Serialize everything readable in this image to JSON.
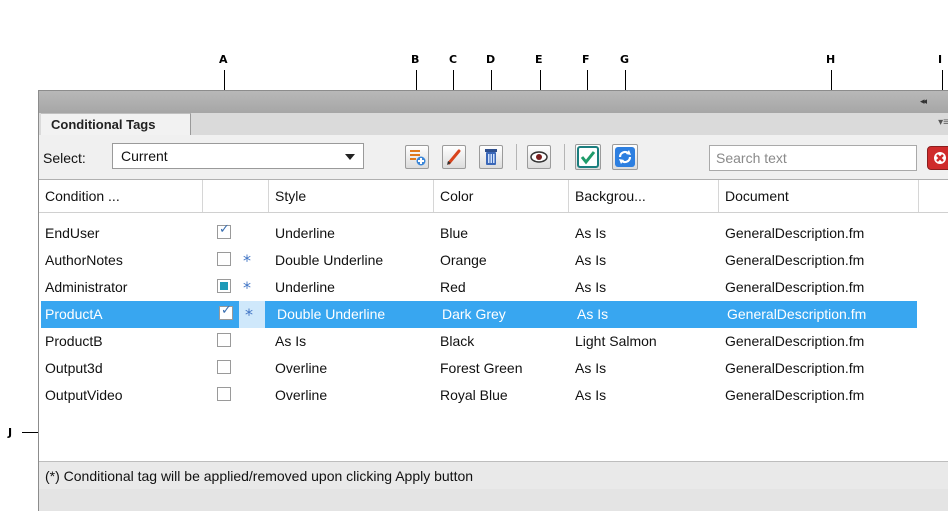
{
  "callouts": {
    "A": "A",
    "B": "B",
    "C": "C",
    "D": "D",
    "E": "E",
    "F": "F",
    "G": "G",
    "H": "H",
    "I": "I",
    "J": "J"
  },
  "panel": {
    "tab_title": "Conditional Tags",
    "collapse_glyph": "◂◂",
    "menu_glyph": "▾≡"
  },
  "toolbar": {
    "select_label": "Select:",
    "select_value": "Current",
    "search_placeholder": "Search text",
    "icons": [
      "new-tag-icon",
      "edit-icon",
      "delete-icon",
      "show-hide-icon",
      "apply-check-icon",
      "refresh-icon",
      "clear-search-icon"
    ]
  },
  "table": {
    "columns": [
      "Condition ...",
      "",
      "Style",
      "Color",
      "Backgrou...",
      "Document"
    ],
    "rows": [
      {
        "name": "EndUser",
        "check": "on",
        "star": "",
        "style": "Underline",
        "color": "Blue",
        "background": "As Is",
        "document": "GeneralDescription.fm"
      },
      {
        "name": "AuthorNotes",
        "check": "off",
        "star": "*",
        "style": "Double Underline",
        "color": "Orange",
        "background": "As Is",
        "document": "GeneralDescription.fm"
      },
      {
        "name": "Administrator",
        "check": "partial",
        "star": "*",
        "style": "Underline",
        "color": "Red",
        "background": "As Is",
        "document": "GeneralDescription.fm"
      },
      {
        "name": "ProductA",
        "check": "on",
        "star": "*",
        "style": "Double Underline",
        "color": "Dark Grey",
        "background": "As Is",
        "document": "GeneralDescription.fm",
        "selected": true
      },
      {
        "name": "ProductB",
        "check": "off",
        "star": "",
        "style": "As Is",
        "color": "Black",
        "background": "Light Salmon",
        "document": "GeneralDescription.fm"
      },
      {
        "name": "Output3d",
        "check": "off",
        "star": "",
        "style": "Overline",
        "color": "Forest Green",
        "background": "As Is",
        "document": "GeneralDescription.fm"
      },
      {
        "name": "OutputVideo",
        "check": "off",
        "star": "",
        "style": "Overline",
        "color": "Royal Blue",
        "background": "As Is",
        "document": "GeneralDescription.fm"
      }
    ]
  },
  "status": {
    "text": "(*) Conditional tag will be applied/removed upon clicking Apply button"
  },
  "colors": {
    "selection": "#38a6f0",
    "star": "#3f73c4",
    "clear_button": "#cf2b2b"
  }
}
